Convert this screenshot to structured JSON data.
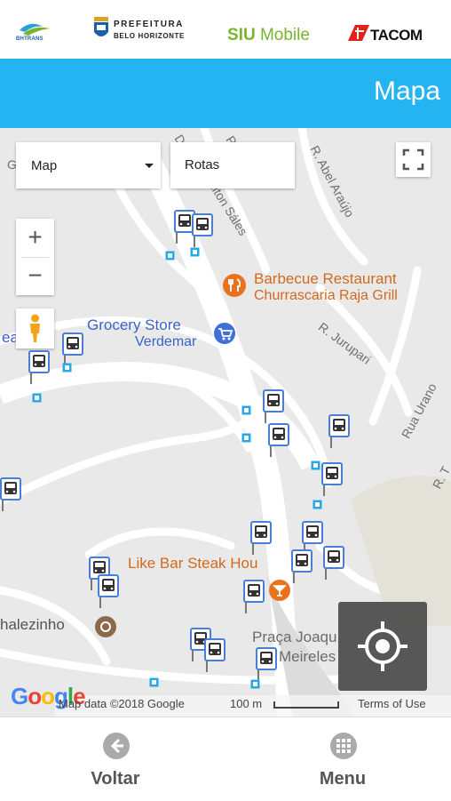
{
  "logos": {
    "bhtrans": "BHTRANS",
    "prefeitura_line1": "PREFEITURA",
    "prefeitura_line2": "BELO HORIZONTE",
    "siu_bold": "SIU",
    "siu_rest": " Mobile",
    "tacom": "TACOM"
  },
  "header": {
    "title": "Mapa"
  },
  "map": {
    "type_select": "Map",
    "routes_input": "Rotas",
    "zoom_in": "+",
    "zoom_out": "−",
    "places": {
      "bbq_name": "Barbecue Restaurant",
      "bbq_sub": "Churrascaria Raja Grill",
      "grocery_name": "Grocery Store",
      "grocery_sub": "Verdemar",
      "likebar": "Like Bar Steak Hou",
      "chalezinho": "halezinho",
      "praca_1": "Praça Joaqu",
      "praca_2": "Meireles",
      "left_fragment": "ea"
    },
    "streets": {
      "salles": "ilton Sáles",
      "abel": "R. Abel Araújo",
      "jurupari": "R. Jurupari",
      "urano": "Rua Urano",
      "r_tail": "R. T",
      "g_frag": "G",
      "p_frag": "P",
      "d_frag": "D"
    },
    "attribution": {
      "google": "Google",
      "map_data": "Map data ©2018 Google",
      "scale": "100 m",
      "terms": "Terms of Use"
    },
    "colors": {
      "poi_orange": "#e8731f",
      "poi_blue": "#3f6fd9",
      "bus_blue": "#4a7ed6"
    }
  },
  "bottom_nav": {
    "back": "Voltar",
    "menu": "Menu"
  },
  "theme": {
    "header_blue": "#25b4f2",
    "siu_green": "#7ab32e"
  }
}
